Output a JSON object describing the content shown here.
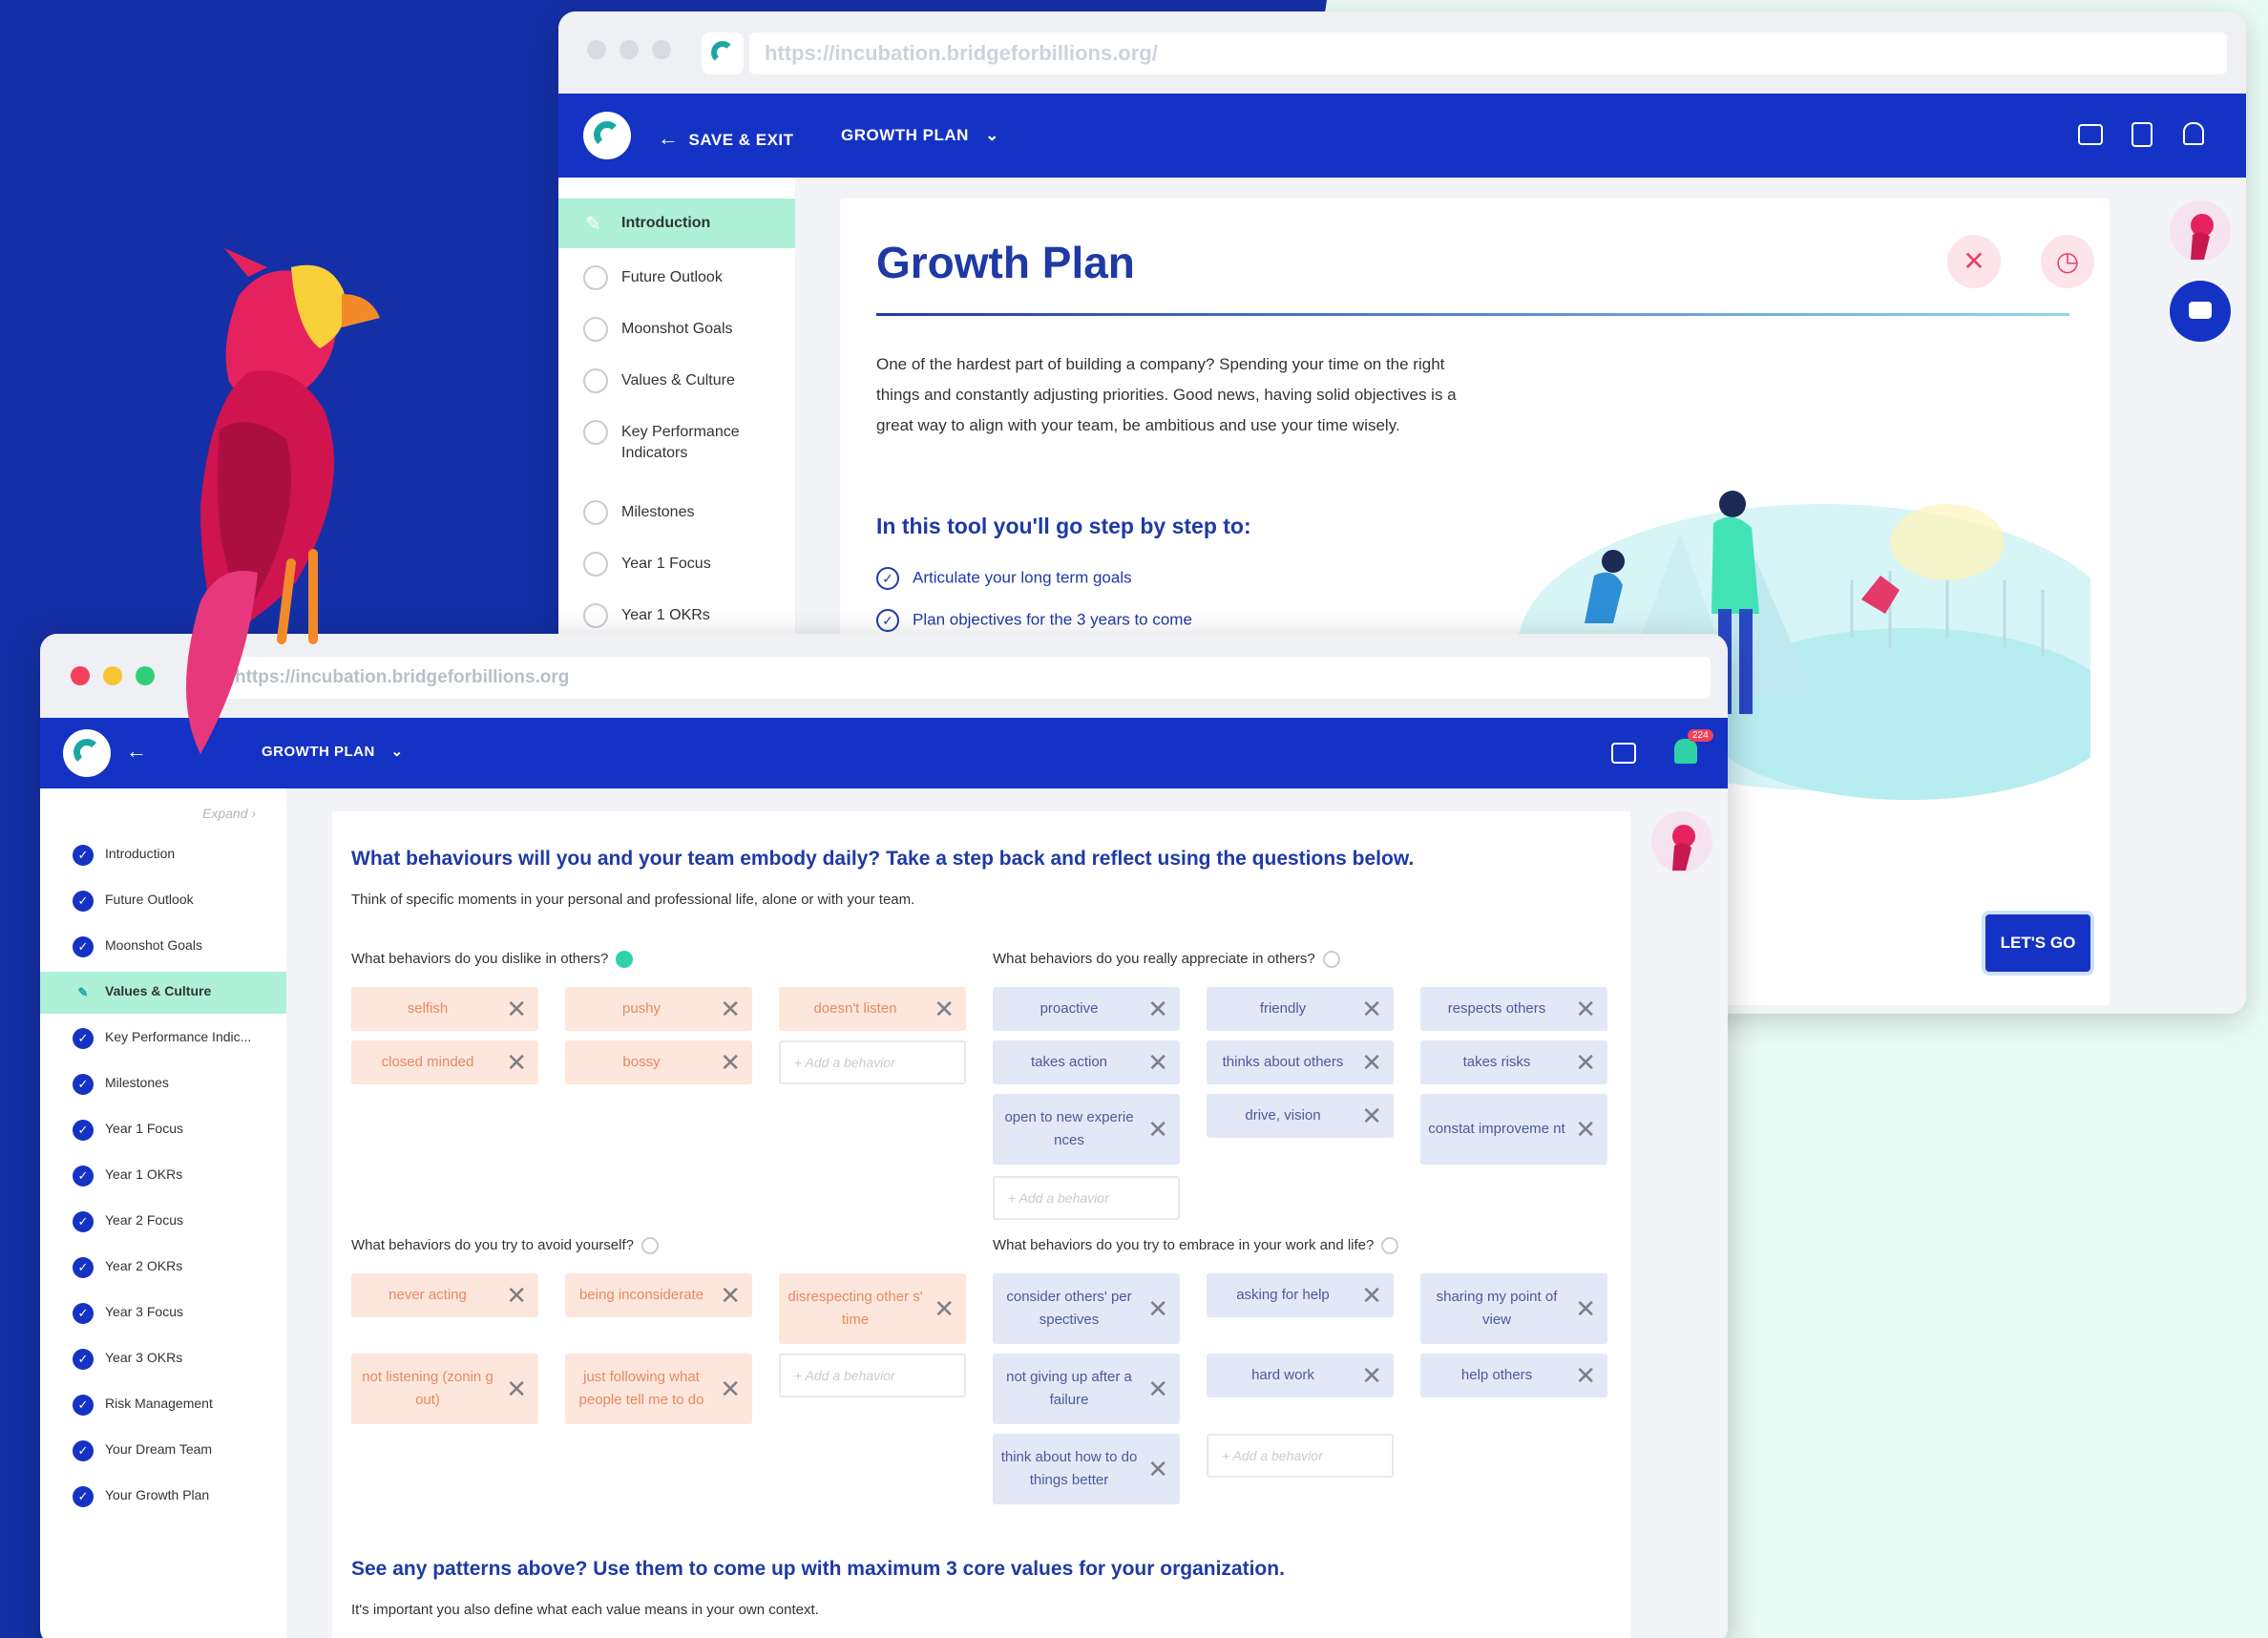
{
  "colors": {
    "background_blue": "#1530a6",
    "nav_blue": "#1432c4",
    "title_blue": "#1f3aa5",
    "active_mint": "#aef0d8",
    "negative_chip": "#fde6dc",
    "positive_chip": "#e3e8f6"
  },
  "back_window": {
    "url": "https://incubation.bridgeforbillions.org/",
    "nav": {
      "save_exit": "SAVE & EXIT",
      "growth_plan": "GROWTH PLAN"
    },
    "sidebar": [
      {
        "label": "Introduction"
      },
      {
        "label": "Future Outlook"
      },
      {
        "label": "Moonshot Goals"
      },
      {
        "label": "Values & Culture"
      },
      {
        "label": "Key Performance Indicators"
      },
      {
        "label": "Milestones"
      },
      {
        "label": "Year 1 Focus"
      },
      {
        "label": "Year 1 OKRs"
      }
    ],
    "title": "Growth Plan",
    "intro": "One of the hardest part of building a company? Spending your time on the right things and constantly adjusting priorities. Good news, having solid objectives is a great way to align with your team, be ambitious and use your time wisely.",
    "subtitle": "In this tool you'll go step by step to:",
    "steps": [
      "Articulate your long term goals",
      "Plan objectives for the 3 years to come"
    ],
    "cta": "LET'S GO"
  },
  "front_window": {
    "url": "https://incubation.bridgeforbillions.org",
    "nav": {
      "growth_plan": "GROWTH PLAN",
      "notification_count": "224"
    },
    "expand": "Expand",
    "sidebar": [
      {
        "label": "Introduction"
      },
      {
        "label": "Future Outlook"
      },
      {
        "label": "Moonshot Goals"
      },
      {
        "label": "Values & Culture"
      },
      {
        "label": "Key Performance Indic..."
      },
      {
        "label": "Milestones"
      },
      {
        "label": "Year 1 Focus"
      },
      {
        "label": "Year 1 OKRs"
      },
      {
        "label": "Year 2 Focus"
      },
      {
        "label": "Year 2 OKRs"
      },
      {
        "label": "Year 3 Focus"
      },
      {
        "label": "Year 3 OKRs"
      },
      {
        "label": "Risk Management"
      },
      {
        "label": "Your Dream Team"
      },
      {
        "label": "Your Growth Plan"
      }
    ],
    "question_title": "What behaviours will you and your team embody daily? Take a step back and reflect using the questions below.",
    "question_desc": "Think of specific moments in your personal and professional life, alone or with your team.",
    "add_placeholder": "+ Add a behavior",
    "groups": {
      "dislike": {
        "title": "What behaviors do you dislike in others?",
        "chips": [
          "selfish",
          "pushy",
          "doesn't listen",
          "closed minded",
          "bossy"
        ]
      },
      "appreciate": {
        "title": "What behaviors do you really appreciate in others?",
        "chips": [
          "proactive",
          "friendly",
          "respects others",
          "takes action",
          "thinks about others",
          "takes risks",
          "open to new experie nces",
          "drive, vision",
          "constat improveme nt"
        ]
      },
      "avoid": {
        "title": "What behaviors do you try to avoid yourself?",
        "chips": [
          "never acting",
          "being inconsiderate",
          "disrespecting other s' time",
          "not listening (zonin g out)",
          "just following what people tell me to do"
        ]
      },
      "embrace": {
        "title": "What behaviors do you try to embrace in your work and life?",
        "chips": [
          "consider others' per spectives",
          "asking for help",
          "sharing my point of view",
          "not giving up after a failure",
          "hard work",
          "help others",
          "think about how to do things better"
        ]
      }
    },
    "patterns_title": "See any patterns above? Use them to come up with maximum 3 core values for your organization.",
    "patterns_desc": "It's important you also define what each value means in your own context."
  }
}
